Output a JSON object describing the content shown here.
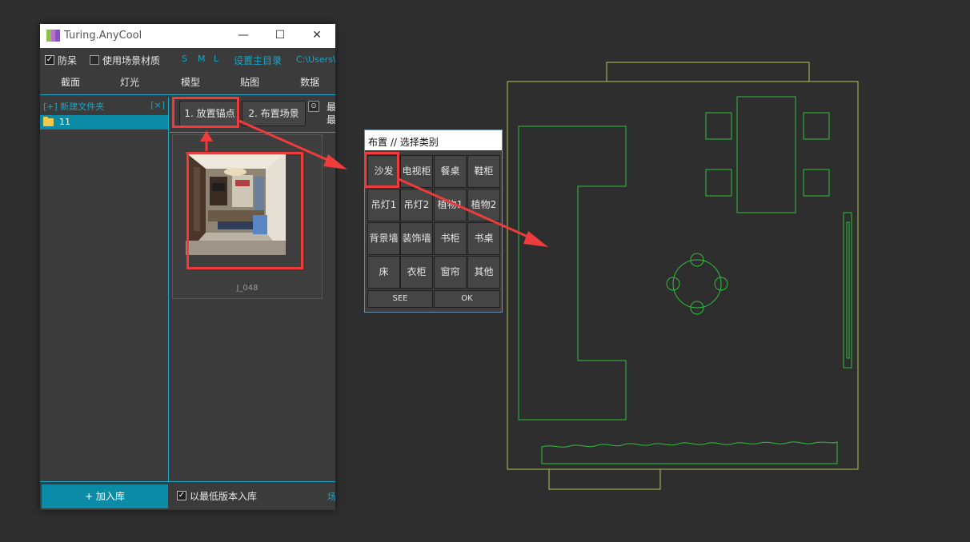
{
  "window": {
    "title": "Turing.AnyCool",
    "minimize_glyph": "—",
    "maximize_glyph": "☐",
    "close_glyph": "✕"
  },
  "options": {
    "anti_stuck": "防呆",
    "use_scene_material": "使用场景材质",
    "size_s": "S",
    "size_m": "M",
    "size_l": "L",
    "set_main_dir": "设置主目录",
    "path": "C:\\Users\\"
  },
  "menu": [
    "截面",
    "灯光",
    "模型",
    "贴图",
    "数据"
  ],
  "left_panel": {
    "new_folder": "[+] 新建文件夹",
    "close_mark": "[×]",
    "folders": [
      {
        "name": "11"
      }
    ]
  },
  "toolbar": {
    "place_anchor": "1. 放置锚点",
    "place_scene": "2. 布置场景",
    "truncated_1": "最",
    "truncated_2": "最"
  },
  "thumbnail": {
    "label": "J_048"
  },
  "bottom": {
    "add_library": "+ 加入库",
    "lowest_version": "以最低版本入库",
    "truncated": "场"
  },
  "dialog": {
    "title": "布置 // 选择类别",
    "categories": [
      [
        "沙发",
        "电视柜",
        "餐桌",
        "鞋柜"
      ],
      [
        "吊灯1",
        "吊灯2",
        "植物1",
        "植物2"
      ],
      [
        "背景墙",
        "装饰墙",
        "书柜",
        "书桌"
      ],
      [
        "床",
        "衣柜",
        "窗帘",
        "其他"
      ]
    ],
    "see": "SEE",
    "ok": "OK"
  },
  "colors": {
    "accent": "#0b8ba6",
    "highlight": "#ee3b3b",
    "plan_outline": "#b8c45a",
    "plan_furniture": "#2fbf3a"
  }
}
